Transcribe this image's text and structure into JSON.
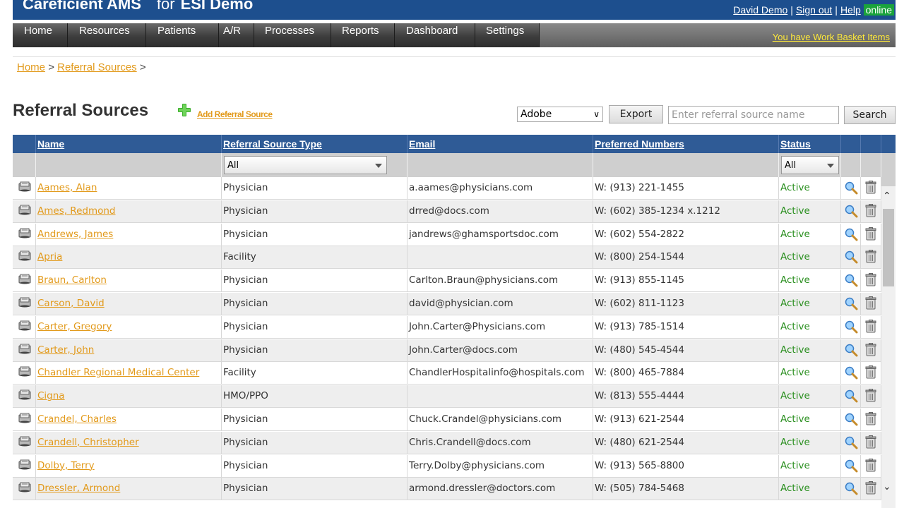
{
  "header": {
    "app_name": "Careficient AMS",
    "for_prefix": "for",
    "org": "ESI Demo",
    "user": "David Demo",
    "signout": "Sign out",
    "help": "Help",
    "online": "online",
    "separator": "|"
  },
  "nav": {
    "items": [
      "Home",
      "Resources",
      "Patients",
      "A/R",
      "Processes",
      "Reports",
      "Dashboard",
      "Settings"
    ],
    "work_basket": "You have Work Basket Items"
  },
  "breadcrumb": {
    "home": "Home",
    "current": "Referral Sources",
    "sep": ">"
  },
  "page": {
    "title": "Referral Sources",
    "add_link": "Add Referral Source",
    "export_format": "Adobe",
    "export_label": "Export",
    "search_placeholder": "Enter referral source name",
    "search_label": "Search"
  },
  "table": {
    "columns": [
      "Name",
      "Referral Source Type",
      "Email",
      "Preferred Numbers",
      "Status"
    ],
    "filter_type": "All",
    "filter_status": "All",
    "rows": [
      {
        "name": "Aames, Alan",
        "type": "Physician",
        "email": "a.aames@physicians.com",
        "phone": "W: (913) 221-1455",
        "status": "Active"
      },
      {
        "name": "Ames, Redmond",
        "type": "Physician",
        "email": "drred@docs.com",
        "phone": "W: (602) 385-1234 x.1212",
        "status": "Active"
      },
      {
        "name": "Andrews, James",
        "type": "Physician",
        "email": "jandrews@ghamsportsdoc.com",
        "phone": "W: (602) 554-2822",
        "status": "Active"
      },
      {
        "name": "Apria",
        "type": "Facility",
        "email": "",
        "phone": "W: (800) 254-1544",
        "status": "Active"
      },
      {
        "name": "Braun, Carlton",
        "type": "Physician",
        "email": "Carlton.Braun@physicians.com",
        "phone": "W: (913) 855-1145",
        "status": "Active"
      },
      {
        "name": "Carson, David",
        "type": "Physician",
        "email": "david@physician.com",
        "phone": "W: (602) 811-1123",
        "status": "Active"
      },
      {
        "name": "Carter, Gregory",
        "type": "Physician",
        "email": "John.Carter@Physicians.com",
        "phone": "W: (913) 785-1514",
        "status": "Active"
      },
      {
        "name": "Carter, John",
        "type": "Physician",
        "email": "John.Carter@docs.com",
        "phone": "W: (480) 545-4544",
        "status": "Active"
      },
      {
        "name": "Chandler Regional Medical Center",
        "type": "Facility",
        "email": "ChandlerHospitalinfo@hospitals.com",
        "phone": "W: (800) 465-7884",
        "status": "Active"
      },
      {
        "name": "Cigna",
        "type": "HMO/PPO",
        "email": "",
        "phone": "W: (813) 555-4444",
        "status": "Active"
      },
      {
        "name": "Crandel, Charles",
        "type": "Physician",
        "email": "Chuck.Crandel@physicians.com",
        "phone": "W: (913) 621-2544",
        "status": "Active"
      },
      {
        "name": "Crandell, Christopher",
        "type": "Physician",
        "email": "Chris.Crandell@docs.com",
        "phone": "W: (480) 621-2544",
        "status": "Active"
      },
      {
        "name": "Dolby, Terry",
        "type": "Physician",
        "email": "Terry.Dolby@physicians.com",
        "phone": "W: (913) 565-8800",
        "status": "Active"
      },
      {
        "name": "Dressler, Armond",
        "type": "Physician",
        "email": "armond.dressler@doctors.com",
        "phone": "W: (505) 784-5468",
        "status": "Active"
      }
    ]
  }
}
